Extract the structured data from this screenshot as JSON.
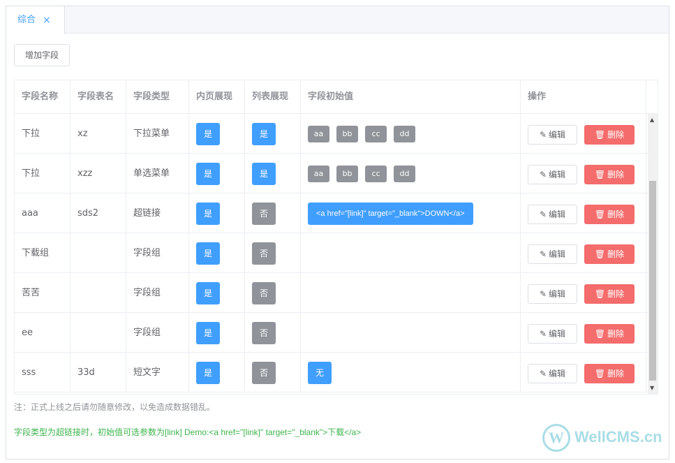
{
  "tabs": [
    {
      "label": "综合",
      "close": "×"
    }
  ],
  "add_button": "增加字段",
  "columns": [
    "字段名称",
    "字段表名",
    "字段类型",
    "内页展现",
    "列表展现",
    "字段初始值",
    "操作"
  ],
  "rows": [
    {
      "name": "下拉",
      "table": "xz",
      "type": "下拉菜单",
      "inner": "是",
      "inner_on": true,
      "list": "是",
      "list_on": true,
      "options": [
        "aa",
        "bb",
        "cc",
        "dd"
      ],
      "initial": null
    },
    {
      "name": "下拉",
      "table": "xzz",
      "type": "单选菜单",
      "inner": "是",
      "inner_on": true,
      "list": "是",
      "list_on": true,
      "options": [
        "aa",
        "bb",
        "cc",
        "dd"
      ],
      "initial": null
    },
    {
      "name": "aaa",
      "table": "sds2",
      "type": "超链接",
      "inner": "是",
      "inner_on": true,
      "list": "否",
      "list_on": false,
      "options": [],
      "initial": "<a href=\"[link]\" target=\"_blank\">DOWN</a>"
    },
    {
      "name": "下载组",
      "table": "",
      "type": "字段组",
      "inner": "是",
      "inner_on": true,
      "list": "否",
      "list_on": false,
      "options": [],
      "initial": null
    },
    {
      "name": "苦苦",
      "table": "",
      "type": "字段组",
      "inner": "是",
      "inner_on": true,
      "list": "否",
      "list_on": false,
      "options": [],
      "initial": null
    },
    {
      "name": "ee",
      "table": "",
      "type": "字段组",
      "inner": "是",
      "inner_on": true,
      "list": "否",
      "list_on": false,
      "options": [],
      "initial": null
    },
    {
      "name": "sss",
      "table": "33d",
      "type": "短文字",
      "inner": "是",
      "inner_on": true,
      "list": "否",
      "list_on": false,
      "options": [],
      "initial": "无"
    }
  ],
  "actions": {
    "edit": "编辑",
    "delete": "删除"
  },
  "notes": {
    "warning": "注：正式上线之后请勿随意修改，以免造成数据错乱。",
    "hint": "字段类型为超链接时，初始值可选参数为[link] Demo:<a href=\"[link]\" target=\"_blank\">下载</a>"
  },
  "watermark": {
    "letter": "W",
    "text": "WellCMS.cn"
  },
  "colors": {
    "primary": "#409eff",
    "danger": "#f56c6c",
    "info": "#909399",
    "success": "#3eb44d"
  }
}
